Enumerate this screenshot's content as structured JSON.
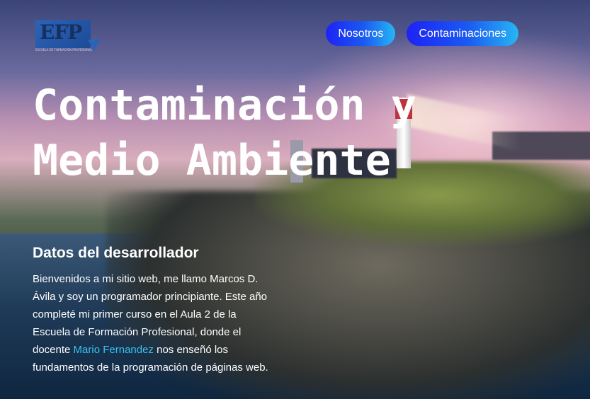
{
  "logo": {
    "text": "EFP",
    "subtext": "ESCUELA DE FORMACIÓN PROFESIONAL"
  },
  "nav": {
    "items": [
      {
        "label": "Nosotros"
      },
      {
        "label": "Contaminaciones"
      }
    ]
  },
  "hero": {
    "title": "Contaminación y Medio Ambiente",
    "subtitle": "Datos del desarrollador",
    "bio_before": "Bienvenidos a mi sitio web, me llamo Marcos D. Ávila y soy un programador principiante. Este año completé mi primer curso en el Aula 2 de la Escuela de Formación Profesional, donde el docente ",
    "bio_link": "Mario Fernandez",
    "bio_after": " nos enseñó los fundamentos de la programación de páginas web."
  },
  "colors": {
    "nav_gradient_start": "#1e22f5",
    "nav_gradient_end": "#27b6f3",
    "link": "#39c3ef",
    "text": "#ffffff"
  }
}
